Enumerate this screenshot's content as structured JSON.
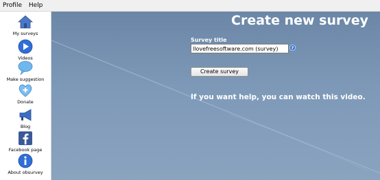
{
  "menu": {
    "items": [
      "Profile",
      "Help"
    ]
  },
  "sidebar": {
    "items": [
      {
        "label": "My surveys",
        "icon": "home-icon"
      },
      {
        "label": "Videos",
        "icon": "play-icon"
      },
      {
        "label": "Make suggestion",
        "icon": "speech-bubble-icon"
      },
      {
        "label": "Donate",
        "icon": "heart-plus-icon"
      },
      {
        "label": "Blog",
        "icon": "megaphone-icon"
      },
      {
        "label": "Facebook page",
        "icon": "facebook-icon"
      },
      {
        "label": "About obsurvey",
        "icon": "info-icon"
      }
    ]
  },
  "main": {
    "title": "Create new survey",
    "survey_title_label": "Survey title",
    "survey_title_value": "llovefreesoftware.com (survey)",
    "create_button": "Create survey",
    "help_text": "If you want help, you can watch this video."
  },
  "colors": {
    "background": "#7e99b8",
    "icon_blue": "#2f6fd6",
    "text_on_background": "#ffffff"
  }
}
